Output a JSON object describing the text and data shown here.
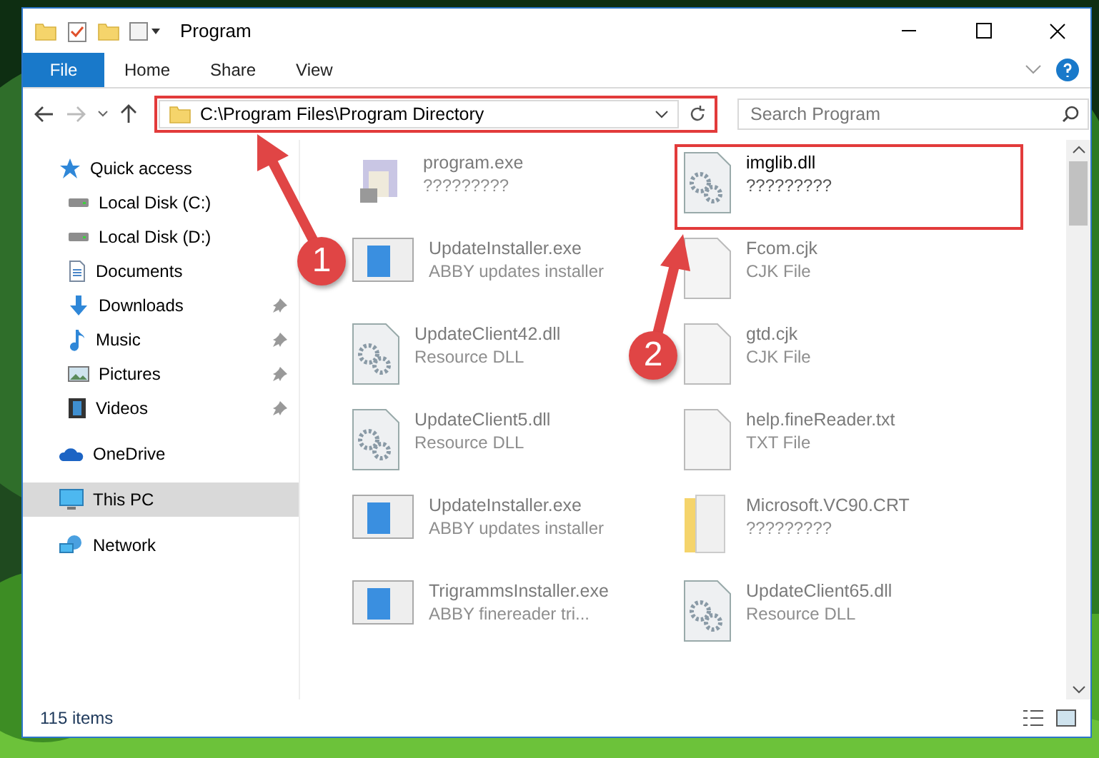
{
  "window": {
    "title": "Program"
  },
  "ribbon_tabs": [
    {
      "label": "File",
      "selected": true
    },
    {
      "label": "Home",
      "selected": false
    },
    {
      "label": "Share",
      "selected": false
    },
    {
      "label": "View",
      "selected": false
    }
  ],
  "address": {
    "path": "C:\\Program Files\\Program Directory",
    "highlighted": true
  },
  "search": {
    "placeholder": "Search Program"
  },
  "sidebar": {
    "items": [
      {
        "label": "Quick access",
        "kind": "star",
        "selected": false,
        "pinned": false,
        "children": [
          {
            "label": "Local Disk (C:)",
            "kind": "drive",
            "selected": false,
            "pinned": false
          },
          {
            "label": "Local Disk (D:)",
            "kind": "drive",
            "selected": false,
            "pinned": false
          },
          {
            "label": "Documents",
            "kind": "document",
            "selected": false,
            "pinned": false
          },
          {
            "label": "Downloads",
            "kind": "download",
            "selected": false,
            "pinned": true
          },
          {
            "label": "Music",
            "kind": "music",
            "selected": false,
            "pinned": true
          },
          {
            "label": "Pictures",
            "kind": "pictures",
            "selected": false,
            "pinned": true
          },
          {
            "label": "Videos",
            "kind": "videos",
            "selected": false,
            "pinned": true
          }
        ]
      },
      {
        "label": "OneDrive",
        "kind": "cloud",
        "selected": false,
        "pinned": false
      },
      {
        "label": "This PC",
        "kind": "computer",
        "selected": true,
        "pinned": false
      },
      {
        "label": "Network",
        "kind": "network",
        "selected": false,
        "pinned": false
      }
    ]
  },
  "files": [
    {
      "name": "program.exe",
      "type": "?????????",
      "kind": "package",
      "blurred": true,
      "highlighted": false
    },
    {
      "name": "imglib.dll",
      "type": "?????????",
      "kind": "dll",
      "blurred": false,
      "highlighted": true
    },
    {
      "name": "UpdateInstaller.exe",
      "type": "ABBY updates installer",
      "kind": "installer",
      "blurred": true,
      "highlighted": false
    },
    {
      "name": "Fcom.cjk",
      "type": "CJK File",
      "kind": "blank",
      "blurred": true,
      "highlighted": false
    },
    {
      "name": "UpdateClient42.dll",
      "type": "Resource DLL",
      "kind": "dll",
      "blurred": true,
      "highlighted": false
    },
    {
      "name": "gtd.cjk",
      "type": "CJK File",
      "kind": "blank",
      "blurred": true,
      "highlighted": false
    },
    {
      "name": "UpdateClient5.dll",
      "type": "Resource DLL",
      "kind": "dll",
      "blurred": true,
      "highlighted": false
    },
    {
      "name": "help.fineReader.txt",
      "type": "TXT File",
      "kind": "blank",
      "blurred": true,
      "highlighted": false
    },
    {
      "name": "UpdateInstaller.exe",
      "type": "ABBY updates installer",
      "kind": "installer",
      "blurred": true,
      "highlighted": false
    },
    {
      "name": "Microsoft.VC90.CRT",
      "type": "?????????",
      "kind": "folder",
      "blurred": true,
      "highlighted": false
    },
    {
      "name": "TrigrammsInstaller.exe",
      "type": "ABBY finereader tri...",
      "kind": "installer",
      "blurred": true,
      "highlighted": false
    },
    {
      "name": "UpdateClient65.dll",
      "type": "Resource DLL",
      "kind": "dll",
      "blurred": true,
      "highlighted": false
    }
  ],
  "status_bar": {
    "count": "115 items"
  },
  "annotations": [
    {
      "number": "1"
    },
    {
      "number": "2"
    }
  ]
}
